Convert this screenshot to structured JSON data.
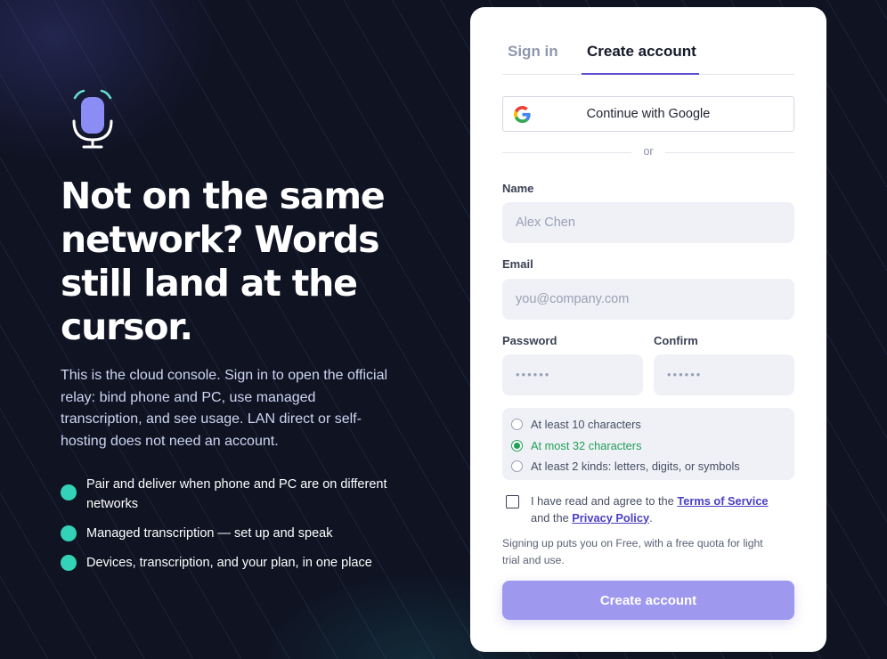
{
  "hero": {
    "headline": "Not on the same network? Words still land at the cursor.",
    "subtext": "This is the cloud console. Sign in to open the official relay: bind phone and PC, use managed transcription, and see usage. LAN direct or self-hosting does not need an account.",
    "features": [
      "Pair and deliver when phone and PC are on different networks",
      "Managed transcription — set up and speak",
      "Devices, transcription, and your plan, in one place"
    ],
    "logo_icon": "microphone-icon"
  },
  "auth": {
    "tabs": {
      "sign_in": "Sign in",
      "create_account": "Create account",
      "active": "create_account"
    },
    "google_button": "Continue with Google",
    "divider": "or",
    "name": {
      "label": "Name",
      "placeholder": "Alex Chen",
      "value": ""
    },
    "email": {
      "label": "Email",
      "placeholder": "you@company.com",
      "value": ""
    },
    "password": {
      "label": "Password",
      "placeholder": "••••••",
      "value": ""
    },
    "confirm": {
      "label": "Confirm",
      "placeholder": "••••••",
      "value": ""
    },
    "rules": [
      {
        "text": "At least 10 characters",
        "met": false
      },
      {
        "text": "At most 32 characters",
        "met": true
      },
      {
        "text": "At least 2 kinds: letters, digits, or symbols",
        "met": false
      }
    ],
    "agreement": {
      "prefix": "I have read and agree to the",
      "terms_link": "Terms of Service",
      "middle": "and the",
      "privacy_link": "Privacy Policy",
      "suffix": ".",
      "checked": false
    },
    "plan_note": "Signing up puts you on Free, with a free quota for light trial and use.",
    "submit_label": "Create account"
  },
  "colors": {
    "background": "#0f1322",
    "accent": "#5b4fcf",
    "feature_dot": "#34d3b8",
    "rule_ok": "#1fa055",
    "submit_bg": "#9e98ee"
  }
}
